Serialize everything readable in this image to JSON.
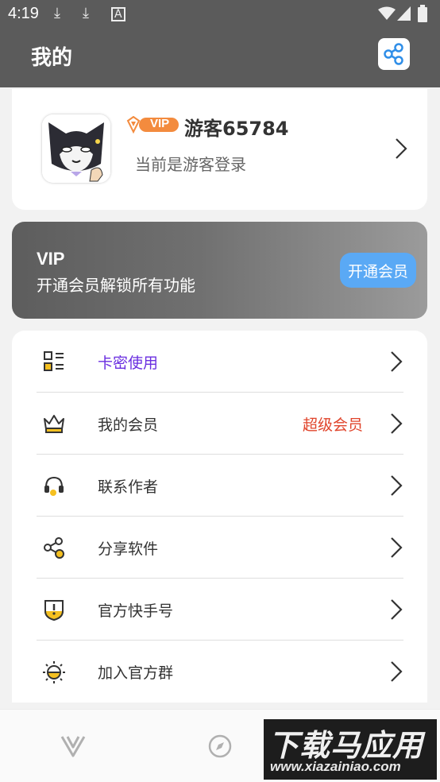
{
  "status_bar": {
    "time": "4:19"
  },
  "header": {
    "title": "我的",
    "share_icon": "share-icon"
  },
  "profile": {
    "vip_badge": "VIP",
    "username": "游客65784",
    "subtitle": "当前是游客登录"
  },
  "vip_banner": {
    "title": "VIP",
    "subtitle": "开通会员解锁所有功能",
    "button_label": "开通会员"
  },
  "menu": {
    "items": [
      {
        "label": "卡密使用",
        "value": "",
        "icon": "qr-card-icon"
      },
      {
        "label": "我的会员",
        "value": "超级会员",
        "icon": "crown-icon"
      },
      {
        "label": "联系作者",
        "value": "",
        "icon": "headset-icon"
      },
      {
        "label": "分享软件",
        "value": "",
        "icon": "share-nodes-icon"
      },
      {
        "label": "官方快手号",
        "value": "",
        "icon": "shield-alert-icon"
      },
      {
        "label": "加入官方群",
        "value": "",
        "icon": "sun-icon"
      }
    ]
  },
  "colors": {
    "header_bg": "#5b5b5b",
    "accent_purple": "#6a2ee0",
    "value_red": "#e0442b",
    "button_blue": "#5aa9f5",
    "icon_yellow": "#f5c020"
  },
  "watermark": {
    "title": "下载马应用",
    "url": "www.xiazainiao.com"
  }
}
